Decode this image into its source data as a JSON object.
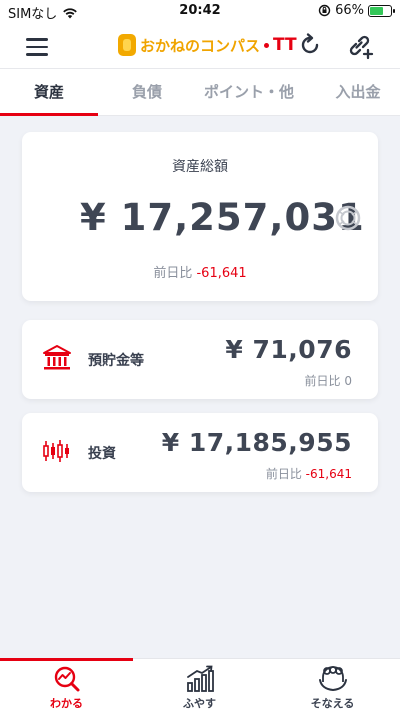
{
  "status_bar": {
    "carrier": "SIMなし",
    "time": "20:42",
    "battery": "66%"
  },
  "header": {
    "logo_text": "おかねのコンパス",
    "logo_suffix": "TT"
  },
  "tabs": [
    {
      "label": "資産",
      "active": true
    },
    {
      "label": "負債",
      "active": false
    },
    {
      "label": "ポイント・他",
      "active": false
    },
    {
      "label": "入出金",
      "active": false
    }
  ],
  "total": {
    "label": "資産総額",
    "amount": "¥ 17,257,031",
    "diff_label": "前日比",
    "diff_value": "-61,641"
  },
  "categories": [
    {
      "label": "預貯金等",
      "amount": "¥ 71,076",
      "diff_label": "前日比",
      "diff_value": "0",
      "icon": "bank-icon"
    },
    {
      "label": "投資",
      "amount": "¥ 17,185,955",
      "diff_label": "前日比",
      "diff_value": "-61,641",
      "icon": "candlestick-icon"
    }
  ],
  "bottom_nav": [
    {
      "label": "わかる",
      "active": true,
      "icon": "magnifier-chart-icon"
    },
    {
      "label": "ふやす",
      "active": false,
      "icon": "growth-chart-icon"
    },
    {
      "label": "そなえる",
      "active": false,
      "icon": "people-protect-icon"
    }
  ],
  "colors": {
    "accent": "#e60012",
    "logo": "#f0a400",
    "text": "#3a4150",
    "background": "#f0f2f7"
  }
}
